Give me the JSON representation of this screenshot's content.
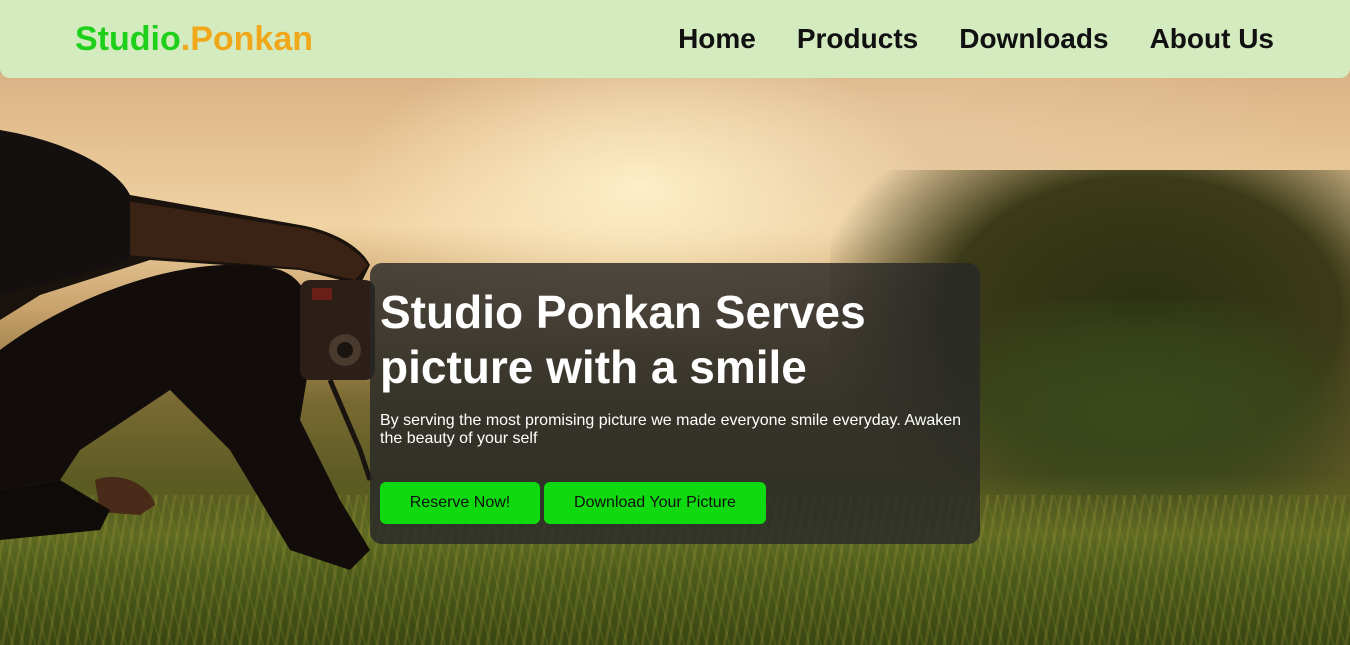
{
  "brand": {
    "part1": "Studio",
    "part2": ".Ponkan"
  },
  "nav": {
    "items": [
      {
        "label": "Home"
      },
      {
        "label": "Products"
      },
      {
        "label": "Downloads"
      },
      {
        "label": "About Us"
      }
    ]
  },
  "hero": {
    "title": "Studio Ponkan Serves picture with a smile",
    "description": "By serving the most promising picture we made everyone smile everyday. Awaken the beauty of your self",
    "reserve_label": "Reserve Now!",
    "download_label": "Download Your Picture"
  },
  "colors": {
    "brand_green": "#1fd01a",
    "brand_orange": "#f0a81a",
    "navbar_bg": "#d4ebc0",
    "button_green": "#0fd90f"
  }
}
